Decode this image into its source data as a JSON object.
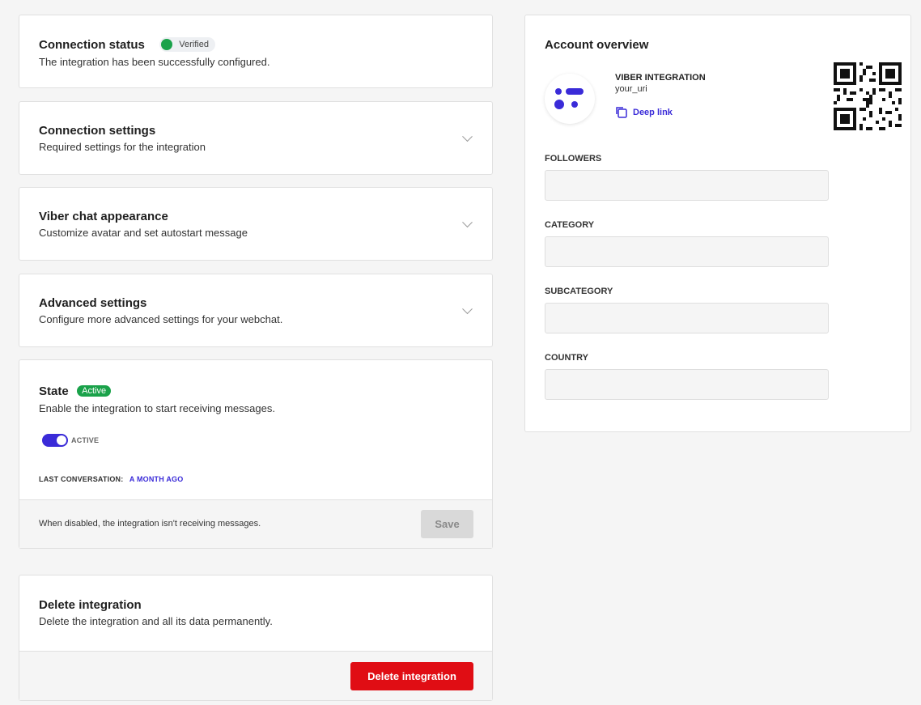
{
  "connection_status": {
    "title": "Connection status",
    "badge": "Verified",
    "description": "The integration has been successfully configured."
  },
  "sections": [
    {
      "title": "Connection settings",
      "description": "Required settings for the integration"
    },
    {
      "title": "Viber chat appearance",
      "description": "Customize avatar and set autostart message"
    },
    {
      "title": "Advanced settings",
      "description": "Configure more advanced settings for your webchat."
    }
  ],
  "state": {
    "title": "State",
    "badge": "Active",
    "description": "Enable the integration to start receiving messages.",
    "toggle_label": "ACTIVE",
    "toggle_on": true,
    "last_conversation_label": "LAST CONVERSATION:",
    "last_conversation_value": "A MONTH AGO",
    "footer_note": "When disabled, the integration isn't receiving messages.",
    "save_label": "Save"
  },
  "delete": {
    "title": "Delete integration",
    "description": "Delete the integration and all its data permanently.",
    "button_label": "Delete integration"
  },
  "account": {
    "title": "Account overview",
    "name": "VIBER INTEGRATION",
    "uri": "your_uri",
    "deep_link_label": "Deep link",
    "fields": [
      {
        "label": "FOLLOWERS",
        "value": ""
      },
      {
        "label": "CATEGORY",
        "value": ""
      },
      {
        "label": "SUBCATEGORY",
        "value": ""
      },
      {
        "label": "COUNTRY",
        "value": ""
      }
    ]
  },
  "colors": {
    "accent": "#3a2bd8",
    "success": "#1aa24a",
    "danger": "#e00d14",
    "background": "#f5f5f5"
  },
  "icons": [
    "chevron-down-icon",
    "copy-icon",
    "qr-code",
    "logo"
  ]
}
